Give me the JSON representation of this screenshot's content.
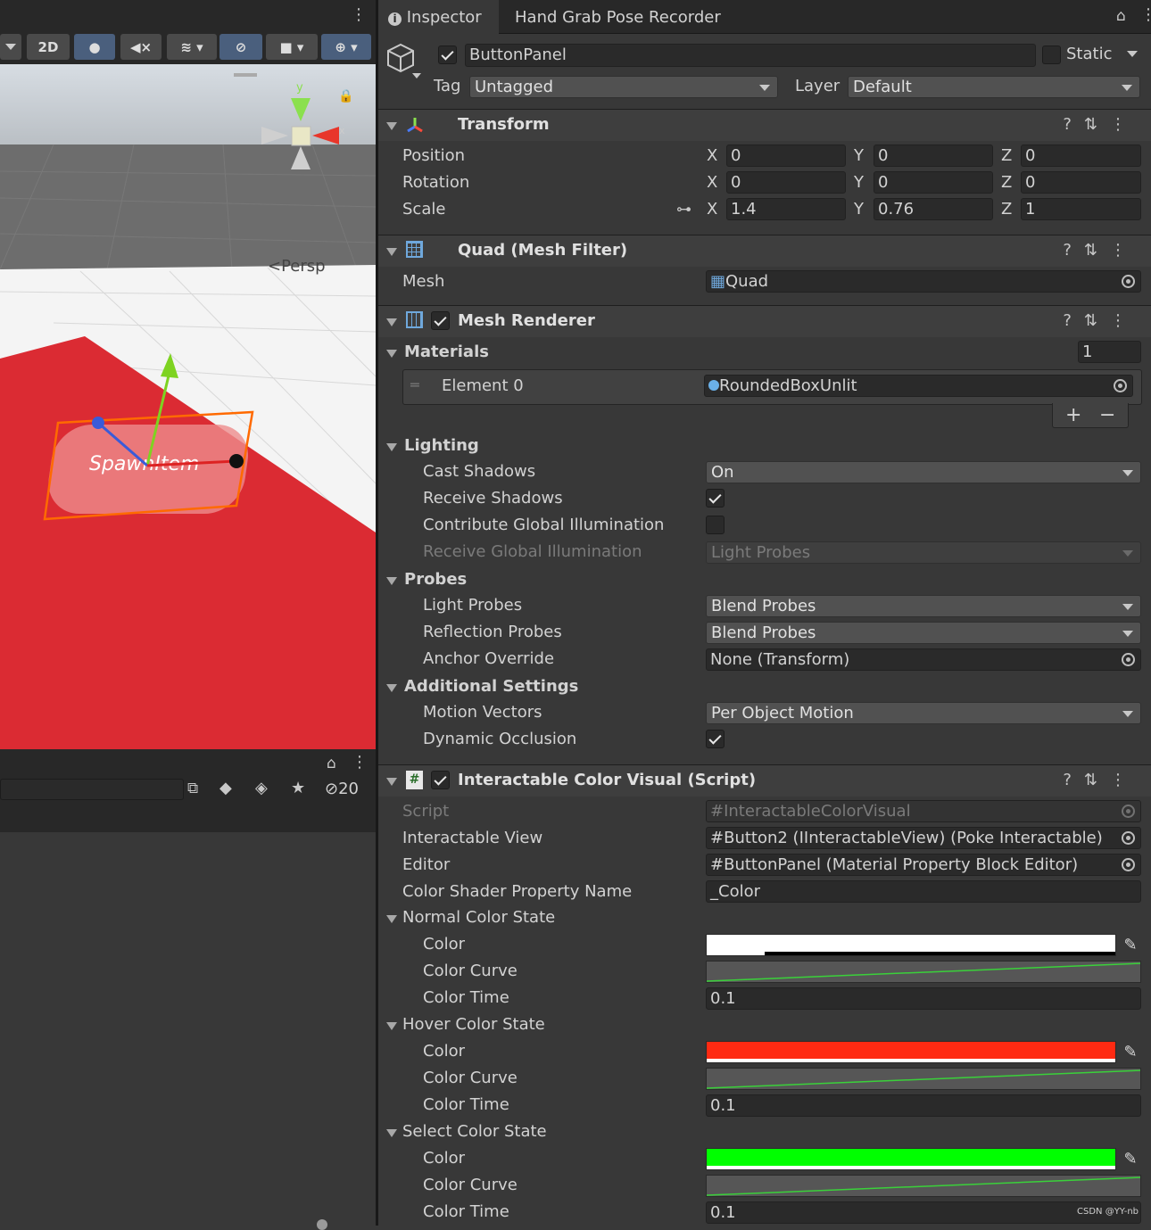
{
  "scene": {
    "toolbar": {
      "mode_2d": "2D"
    },
    "persp_label": "Persp",
    "gizmo_y": "y",
    "gizmo_x": "x",
    "object_label": "SpawnItem"
  },
  "hierarchy": {
    "hidden_count": "20"
  },
  "tabs": {
    "inspector": "Inspector",
    "recorder": "Hand Grab Pose Recorder"
  },
  "object": {
    "name": "ButtonPanel",
    "static_label": "Static",
    "tag_label": "Tag",
    "tag_value": "Untagged",
    "layer_label": "Layer",
    "layer_value": "Default"
  },
  "transform": {
    "title": "Transform",
    "position_label": "Position",
    "rotation_label": "Rotation",
    "scale_label": "Scale",
    "axis_x": "X",
    "axis_y": "Y",
    "axis_z": "Z",
    "position": [
      "0",
      "0",
      "0"
    ],
    "rotation": [
      "0",
      "0",
      "0"
    ],
    "scale": [
      "1.4",
      "0.76",
      "1"
    ]
  },
  "mesh_filter": {
    "title": "Quad (Mesh Filter)",
    "mesh_label": "Mesh",
    "mesh_value": "Quad"
  },
  "mesh_renderer": {
    "title": "Mesh Renderer",
    "materials_label": "Materials",
    "materials_count": "1",
    "element_label": "Element 0",
    "element_value": "RoundedBoxUnlit",
    "add": "+",
    "remove": "−",
    "lighting_label": "Lighting",
    "cast_shadows_label": "Cast Shadows",
    "cast_shadows_value": "On",
    "receive_shadows_label": "Receive Shadows",
    "contribute_gi_label": "Contribute Global Illumination",
    "receive_gi_label": "Receive Global Illumination",
    "receive_gi_value": "Light Probes",
    "probes_label": "Probes",
    "light_probes_label": "Light Probes",
    "light_probes_value": "Blend Probes",
    "reflection_probes_label": "Reflection Probes",
    "reflection_probes_value": "Blend Probes",
    "anchor_override_label": "Anchor Override",
    "anchor_override_value": "None (Transform)",
    "additional_label": "Additional Settings",
    "motion_vectors_label": "Motion Vectors",
    "motion_vectors_value": "Per Object Motion",
    "dynamic_occlusion_label": "Dynamic Occlusion"
  },
  "icv": {
    "title": "Interactable Color Visual (Script)",
    "script_label": "Script",
    "script_value": "InteractableColorVisual",
    "view_label": "Interactable View",
    "view_value": "Button2 (IInteractableView) (Poke Interactable)",
    "editor_label": "Editor",
    "editor_value": "ButtonPanel (Material Property Block Editor)",
    "shader_label": "Color Shader Property Name",
    "shader_value": "_Color",
    "normal_label": "Normal Color State",
    "hover_label": "Hover Color State",
    "select_label": "Select Color State",
    "color_label": "Color",
    "curve_label": "Color Curve",
    "time_label": "Color Time",
    "normal_time": "0.1",
    "hover_time": "0.1",
    "select_time": "0.1",
    "normal_color": "#ffffff",
    "hover_color": "#ff2a12",
    "select_color": "#00ff00"
  },
  "watermark": "CSDN @YY-nb"
}
